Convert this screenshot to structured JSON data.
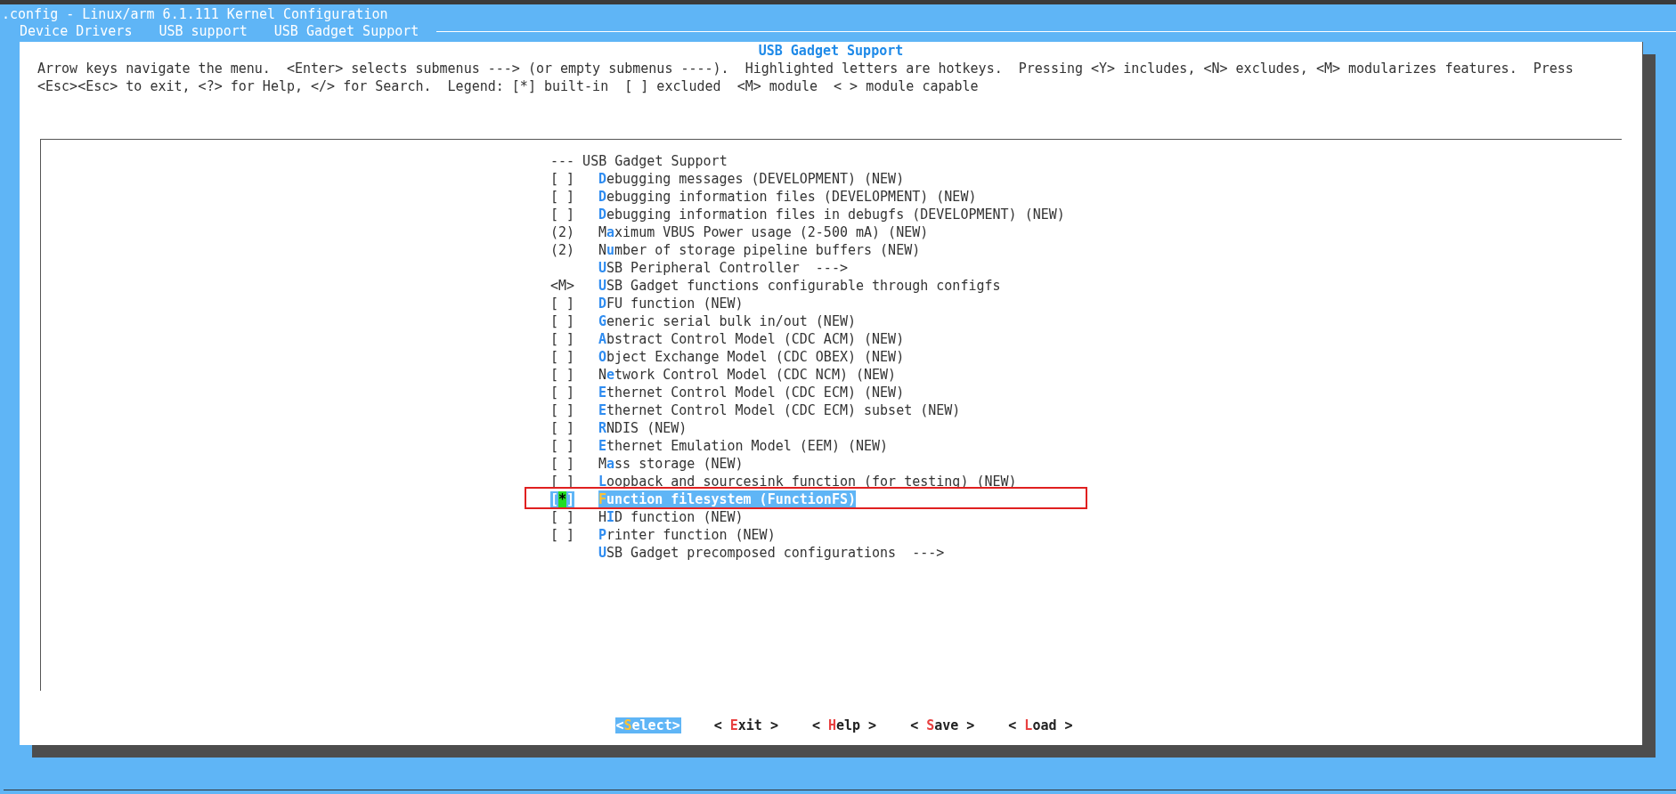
{
  "window": {
    "title": ".config - Linux/arm 6.1.111 Kernel Configuration"
  },
  "breadcrumbs": [
    "Device Drivers",
    "USB support",
    "USB Gadget Support"
  ],
  "dialog": {
    "title": "USB Gadget Support",
    "help_lines": [
      "Arrow keys navigate the menu.  <Enter> selects submenus ---> (or empty submenus ----).  Highlighted letters are hotkeys.  Pressing <Y> includes, <N> excludes, <M> modularizes features.  Press",
      "<Esc><Esc> to exit, <?> for Help, </> for Search.  Legend: [*] built-in  [ ] excluded  <M> module  < > module capable"
    ],
    "items": [
      {
        "kind": "header",
        "text": "--- USB Gadget Support",
        "selected": false
      },
      {
        "kind": "checkbox",
        "indicator": "[ ]",
        "hotkey": "D",
        "after": "ebugging messages (DEVELOPMENT) (NEW)",
        "selected": false
      },
      {
        "kind": "checkbox",
        "indicator": "[ ]",
        "hotkey": "D",
        "after": "ebugging information files (DEVELOPMENT) (NEW)",
        "selected": false
      },
      {
        "kind": "checkbox",
        "indicator": "[ ]",
        "hotkey": "D",
        "after": "ebugging information files in debugfs (DEVELOPMENT) (NEW)",
        "selected": false
      },
      {
        "kind": "value",
        "indicator": "(2)",
        "before": "M",
        "hotkey": "a",
        "after": "ximum VBUS Power usage (2-500 mA) (NEW)",
        "selected": false
      },
      {
        "kind": "value",
        "indicator": "(2)",
        "before": "N",
        "hotkey": "u",
        "after": "mber of storage pipeline buffers (NEW)",
        "selected": false
      },
      {
        "kind": "submenu",
        "hotkey": "U",
        "after": "SB Peripheral Controller  --->",
        "selected": false
      },
      {
        "kind": "module",
        "indicator": "<M>",
        "hotkey": "U",
        "after": "SB Gadget functions configurable through configfs",
        "selected": false
      },
      {
        "kind": "checkbox",
        "indicator": "[ ]",
        "hotkey": "D",
        "after": "FU function (NEW)",
        "selected": false
      },
      {
        "kind": "checkbox",
        "indicator": "[ ]",
        "hotkey": "G",
        "after": "eneric serial bulk in/out (NEW)",
        "selected": false
      },
      {
        "kind": "checkbox",
        "indicator": "[ ]",
        "hotkey": "A",
        "after": "bstract Control Model (CDC ACM) (NEW)",
        "selected": false
      },
      {
        "kind": "checkbox",
        "indicator": "[ ]",
        "hotkey": "O",
        "after": "bject Exchange Model (CDC OBEX) (NEW)",
        "selected": false
      },
      {
        "kind": "checkbox",
        "indicator": "[ ]",
        "before": "N",
        "hotkey": "e",
        "after": "twork Control Model (CDC NCM) (NEW)",
        "selected": false
      },
      {
        "kind": "checkbox",
        "indicator": "[ ]",
        "hotkey": "E",
        "after": "thernet Control Model (CDC ECM) (NEW)",
        "selected": false
      },
      {
        "kind": "checkbox",
        "indicator": "[ ]",
        "hotkey": "E",
        "after": "thernet Control Model (CDC ECM) subset (NEW)",
        "selected": false
      },
      {
        "kind": "checkbox",
        "indicator": "[ ]",
        "hotkey": "R",
        "after": "NDIS (NEW)",
        "selected": false
      },
      {
        "kind": "checkbox",
        "indicator": "[ ]",
        "hotkey": "E",
        "after": "thernet Emulation Model (EEM) (NEW)",
        "selected": false
      },
      {
        "kind": "checkbox",
        "indicator": "[ ]",
        "before": "M",
        "hotkey": "a",
        "after": "ss storage (NEW)",
        "selected": false
      },
      {
        "kind": "checkbox",
        "indicator": "[ ]",
        "hotkey": "L",
        "after": "oopback and sourcesink function (for testing) (NEW)",
        "selected": false
      },
      {
        "kind": "checkbox",
        "indicator": "[*]",
        "hotkey": "F",
        "after": "unction filesystem (FunctionFS)",
        "selected": true,
        "annotated": true
      },
      {
        "kind": "checkbox",
        "indicator": "[ ]",
        "before": "H",
        "hotkey": "I",
        "after": "D function (NEW)",
        "selected": false
      },
      {
        "kind": "checkbox",
        "indicator": "[ ]",
        "hotkey": "P",
        "after": "rinter function (NEW)",
        "selected": false
      },
      {
        "kind": "submenu",
        "hotkey": "U",
        "after": "SB Gadget precomposed configurations  --->",
        "selected": false
      }
    ],
    "buttons": [
      {
        "open": "<",
        "hotkey": "S",
        "after": "elect",
        "close": ">",
        "selected": true
      },
      {
        "open": "<",
        "hotkey": "E",
        "after": "xit",
        "close": ">",
        "selected": false
      },
      {
        "open": "<",
        "hotkey": "H",
        "after": "elp",
        "close": ">",
        "selected": false
      },
      {
        "open": "<",
        "hotkey": "S",
        "after": "ave",
        "close": ">",
        "selected": false
      },
      {
        "open": "<",
        "hotkey": "L",
        "after": "oad",
        "close": ">",
        "selected": false
      }
    ]
  }
}
